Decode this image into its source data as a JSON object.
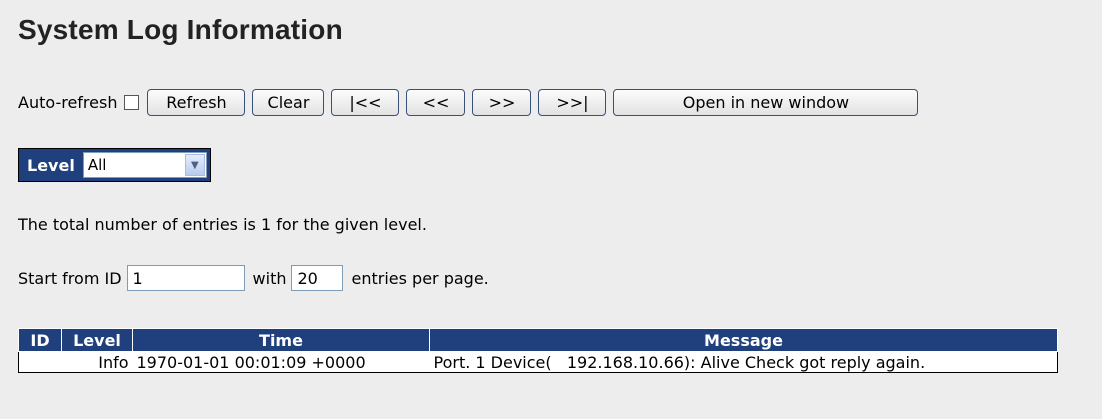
{
  "page": {
    "title": "System Log Information"
  },
  "toolbar": {
    "auto_refresh_label": "Auto-refresh",
    "auto_refresh_checked": false,
    "buttons": {
      "refresh": "Refresh",
      "clear": "Clear",
      "first": "|<<",
      "prev": "<<",
      "next": ">>",
      "last": ">>|",
      "open_new_window": "Open in new window"
    }
  },
  "level_filter": {
    "label": "Level",
    "selected": "All"
  },
  "summary": {
    "text": "The total number of entries is 1 for the given level."
  },
  "paging": {
    "start_label": "Start from ID",
    "start_value": "1",
    "with_label": "with",
    "per_page_value": "20",
    "suffix": "entries per page."
  },
  "table": {
    "columns": [
      "ID",
      "Level",
      "Time",
      "Message"
    ],
    "rows": [
      {
        "id": "",
        "level": "Info",
        "time": "1970-01-01 00:01:09 +0000",
        "message": "Port. 1 Device(   192.168.10.66): Alive Check got reply again."
      }
    ]
  },
  "colors": {
    "header_bg": "#1f3f7d",
    "page_bg": "#ededed"
  }
}
